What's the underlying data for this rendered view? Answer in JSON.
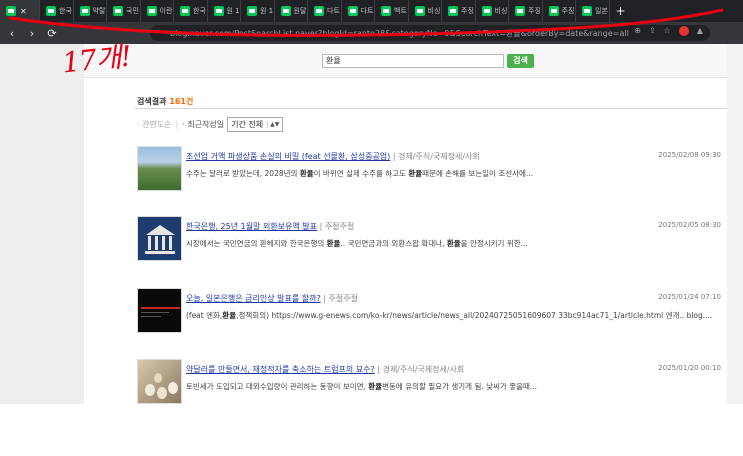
{
  "browser": {
    "tabs": [
      {
        "title": ""
      },
      {
        "title": "한국"
      },
      {
        "title": "약탈"
      },
      {
        "title": "국민"
      },
      {
        "title": "이란"
      },
      {
        "title": "한국"
      },
      {
        "title": "원 1"
      },
      {
        "title": "원 1"
      },
      {
        "title": "원달"
      },
      {
        "title": "다트"
      },
      {
        "title": "다트"
      },
      {
        "title": "백트"
      },
      {
        "title": "비싱"
      },
      {
        "title": "주징"
      },
      {
        "title": "비싱"
      },
      {
        "title": "주징"
      },
      {
        "title": "주징"
      },
      {
        "title": "일본"
      }
    ],
    "url": "blog.naver.com/PostSearchList.naver?blogId=ranto28&categoryNo=0&SearchText=환율&orderBy=date&range=all"
  },
  "annotation": {
    "text": "17개!",
    "color": "#e60012"
  },
  "search": {
    "value": "환율",
    "button_label": "검색"
  },
  "results": {
    "label": "검색결과",
    "count": "161건",
    "filter_relevance": "관련도순",
    "filter_recent": "최근작성일",
    "range_value": "기간 전체"
  },
  "posts": [
    {
      "title": "조선업 거액 파생상품 손실의 비밀 (feat 선물환, 삼성중공업)",
      "category": "| 경제/주식/국제정세/사회",
      "date": "2025/02/08 09:30",
      "snippet_pre": "수주는 달러로 받았는데, 2028년의 ",
      "snippet_b1": "환율",
      "snippet_mid": "이 바뀌면 실제 수주를 하고도 ",
      "snippet_b2": "환율",
      "snippet_post": "때문에 손해를 보는일이 조선사에..."
    },
    {
      "title": "한국은행, 25년 1월말 외환보유액 발표",
      "category": "| 주절주절",
      "date": "2025/02/05 08:30",
      "snippet_pre": "시장에서는 국민연금의 환헤지와 한국은행의 ",
      "snippet_b1": "환율",
      "snippet_mid": ".. 국민연금과의 외환스왑 확대나, ",
      "snippet_b2": "환율",
      "snippet_post": "을 안정시키기 위한..."
    },
    {
      "title": "오늘, 일본은행은 금리인상 발표를 할까?",
      "category": "| 주절주절",
      "date": "2025/01/24 07:10",
      "snippet_pre": "(feat 엔화,",
      "snippet_b1": "환율",
      "snippet_mid": ",정책회의) https://www.g-enews.com/ko-kr/news/article/news_all/20240725051609607 33bc914ac71_1/article.html 엔개.. blog....",
      "snippet_b2": "",
      "snippet_post": ""
    },
    {
      "title": "약달러를 만들면서, 재정적자를 축소하는 트럼프의 묘수?",
      "category": "| 경제/주식/국제정세/사회",
      "date": "2025/01/20 00:10",
      "snippet_pre": "토빈세가 도입되고 대외수입량이 관리하는 동향이 보이면, ",
      "snippet_b1": "환율",
      "snippet_mid": "변동에 유의할 필요가 생기게 됨. 낮씨가 좋을때...",
      "snippet_b2": "",
      "snippet_post": ""
    }
  ]
}
